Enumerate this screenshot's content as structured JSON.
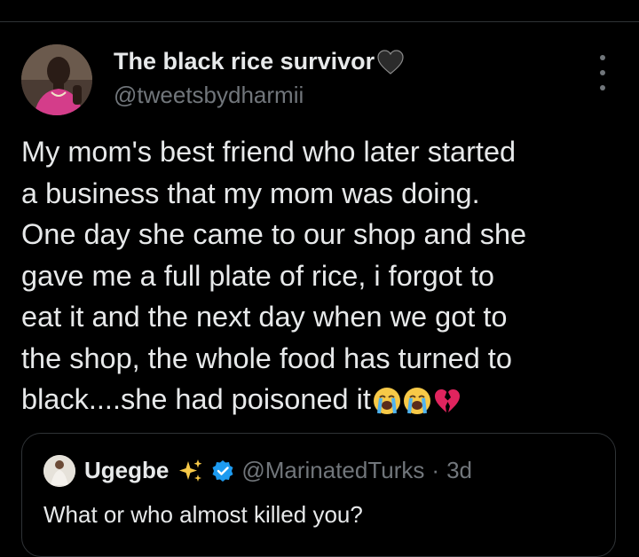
{
  "tweet": {
    "author": {
      "display_name": "The black rice survivor",
      "name_emoji": "black-heart-icon",
      "handle": "@tweetsbydharmii",
      "avatar": "avatar-photo"
    },
    "more_menu_icon": "more-vertical-icon",
    "text": "My mom's best friend who later started\na business that my mom was doing.\nOne day she came to our shop and she\ngave me a full plate of rice, i forgot to\neat it and the next day when we got to\nthe shop, the whole food has turned to\nblack....she had poisoned it",
    "trailing_emojis": [
      "loudly-crying-face-icon",
      "loudly-crying-face-icon",
      "broken-heart-icon"
    ]
  },
  "quote": {
    "author": {
      "display_name": "Ugegbe",
      "name_emoji": "sparkles-icon",
      "verified_icon": "verified-badge-icon",
      "handle": "@MarinatedTurks",
      "separator": "·",
      "time": "3d"
    },
    "text": "What or who almost killed you?"
  },
  "colors": {
    "background": "#000000",
    "primary_text": "#e7e9ea",
    "secondary_text": "#71767b",
    "border": "#2f3336",
    "verified_blue": "#1d9bf0"
  }
}
